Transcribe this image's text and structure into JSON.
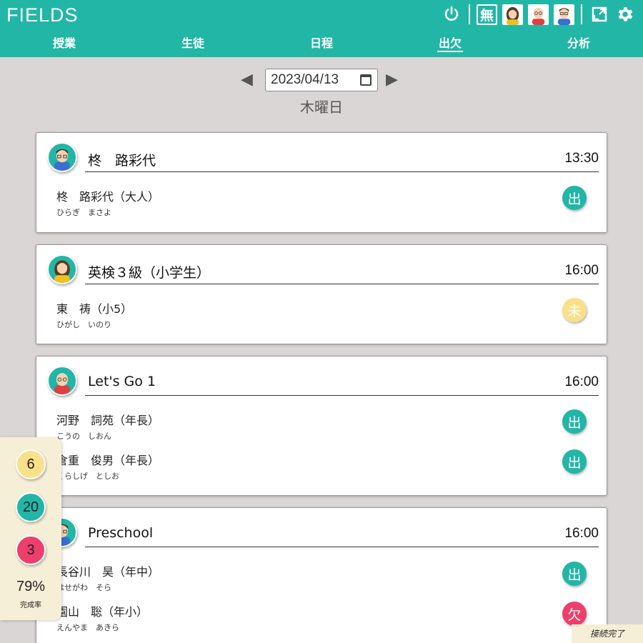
{
  "app": {
    "logo": "FIELDS"
  },
  "nav": {
    "tabs": [
      "授業",
      "生徒",
      "日程",
      "出欠",
      "分析"
    ],
    "active": "出欠"
  },
  "header_icons": {
    "free_label": "無"
  },
  "date": {
    "value": "2023/04/13",
    "weekday": "木曜日",
    "prev": "◀",
    "next": "▶"
  },
  "colors": {
    "brand": "#22b6a6",
    "present": "#22b6a6",
    "pending": "#fbe08a",
    "absent": "#ee3f6c"
  },
  "lessons": [
    {
      "title": "柊　路彩代",
      "time": "13:30",
      "teacher_icon": "teacher-man-glasses-icon",
      "students": [
        {
          "name": "柊　路彩代（大人）",
          "kana": "ひらぎ　まさよ",
          "status": "出",
          "state": "present"
        }
      ]
    },
    {
      "title": "英検３級（小学生）",
      "time": "16:00",
      "teacher_icon": "teacher-woman-icon",
      "students": [
        {
          "name": "東　祷（小5）",
          "kana": "ひがし　いのり",
          "status": "未",
          "state": "pending"
        }
      ]
    },
    {
      "title": "Let's Go 1",
      "time": "16:00",
      "teacher_icon": "teacher-bald-man-icon",
      "students": [
        {
          "name": "河野　詞苑（年長）",
          "kana": "こうの　しおん",
          "status": "出",
          "state": "present"
        },
        {
          "name": "倉重　俊男（年長）",
          "kana": "くらしげ　としお",
          "status": "出",
          "state": "present"
        }
      ]
    },
    {
      "title": "Preschool",
      "time": "16:00",
      "teacher_icon": "teacher-man-glasses-icon",
      "students": [
        {
          "name": "長谷川　昊（年中）",
          "kana": "はせがわ　そら",
          "status": "出",
          "state": "present"
        },
        {
          "name": "園山　聡（年小）",
          "kana": "えんやま　あきら",
          "status": "欠",
          "state": "absent"
        }
      ]
    }
  ],
  "stats": {
    "pending": "6",
    "present": "20",
    "absent": "3",
    "rate": "79%",
    "rate_label": "完成率"
  },
  "status_bar": {
    "text": "接続完了"
  }
}
